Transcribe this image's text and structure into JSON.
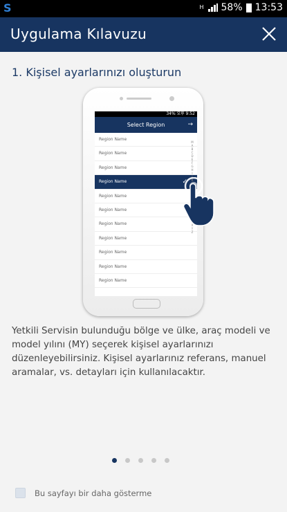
{
  "status_bar": {
    "network": "H",
    "battery_percent": "58%",
    "time": "13:53"
  },
  "app_bar": {
    "title": "Uygulama Kılavuzu"
  },
  "step": {
    "title": "1. Kişisel ayarlarınızı oluşturun"
  },
  "illustration": {
    "status_text": "34% 오후 9:52",
    "header_title": "Select Region",
    "rows": [
      "Region Name",
      "Region Name",
      "Region Name",
      "Region Name",
      "Region Name",
      "Region Name",
      "Region Name",
      "Region Name",
      "Region Name",
      "Region Name",
      "Region Name"
    ],
    "selected_index": 3,
    "alphabet": [
      "M",
      "A",
      "B",
      "C",
      "D",
      "E",
      "F",
      "G",
      "H",
      "I",
      "J",
      "K",
      "L",
      "M",
      "N",
      "O",
      "P",
      "Q",
      "R",
      "S",
      "T",
      "U",
      "V",
      "W",
      "X",
      "Y",
      "Z"
    ]
  },
  "description": "Yetkili Servisin bulunduğu bölge ve ülke, araç modeli ve model yılını (MY) seçerek kişisel ayarlarınızı düzenleyebilirsiniz. Kişisel ayarlarınız referans, manuel aramalar, vs. detayları için kullanılacaktır.",
  "pagination": {
    "total": 5,
    "active": 0
  },
  "dont_show": {
    "label": "Bu sayfayı bir daha gösterme",
    "checked": false
  },
  "colors": {
    "primary": "#173460",
    "background": "#f3f3f3"
  }
}
